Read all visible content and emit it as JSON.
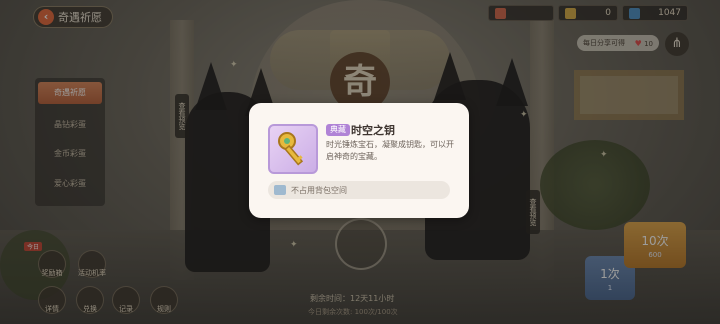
{
  "header": {
    "back_label": "奇遇祈愿",
    "resources": [
      {
        "icon": "ticket-icon",
        "value": ""
      },
      {
        "icon": "gold-coin-icon",
        "value": "0"
      },
      {
        "icon": "diamond-icon",
        "value": "1047"
      }
    ],
    "share_text": "每日分享可得",
    "share_reward": "10"
  },
  "banner": {
    "title_char": "奇"
  },
  "left_tabs": [
    {
      "label": "奇遇祈愿",
      "active": true
    },
    {
      "label": "晶钻彩蛋",
      "active": false
    },
    {
      "label": "金币彩蛋",
      "active": false
    },
    {
      "label": "爱心彩蛋",
      "active": false
    }
  ],
  "side_tags": {
    "left": "查看预览",
    "right": "查看预览"
  },
  "bottom_menu": {
    "badge": "今日",
    "items": [
      {
        "label": "奖励箱",
        "icon": "gift-box-icon"
      },
      {
        "label": "活动机率",
        "icon": "probability-icon"
      },
      {
        "label": "详情",
        "icon": "detail-icon"
      },
      {
        "label": "兑换",
        "icon": "exchange-icon"
      },
      {
        "label": "记录",
        "icon": "record-icon"
      },
      {
        "label": "规则",
        "icon": "rules-icon"
      }
    ]
  },
  "timer": {
    "label": "剩余时间：12天11小时",
    "progress": "今日剩余次数: 100次/100次"
  },
  "draw": {
    "one": {
      "label": "1次",
      "cost": "1"
    },
    "ten": {
      "label": "10次",
      "cost": "600"
    }
  },
  "popup": {
    "badge": "典藏",
    "name": "时空之钥",
    "description": "时光锤炼宝石，凝聚成钥匙，可以开启神奇的宝藏。",
    "slot_text": "不占用背包空间"
  },
  "colors": {
    "accent_orange": "#e5683b",
    "badge_purple": "#b083d6",
    "popup_bg": "#fbf6f1",
    "draw_gold": "#e0a64a",
    "draw_blue": "#6b89b3"
  }
}
